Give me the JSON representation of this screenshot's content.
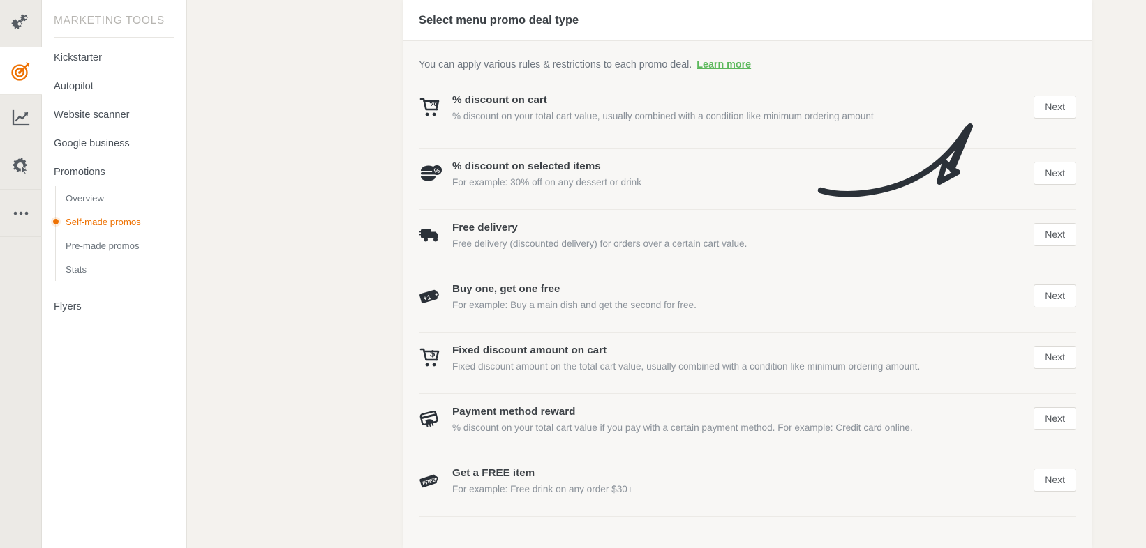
{
  "rail": {
    "items": [
      {
        "name": "settings-gears-icon",
        "active": false
      },
      {
        "name": "marketing-target-icon",
        "active": true
      },
      {
        "name": "analytics-chart-icon",
        "active": false
      },
      {
        "name": "tools-cursor-icon",
        "active": false
      },
      {
        "name": "more-options-icon",
        "active": false
      }
    ]
  },
  "sidebar": {
    "title": "MARKETING TOOLS",
    "items": [
      {
        "label": "Kickstarter"
      },
      {
        "label": "Autopilot"
      },
      {
        "label": "Website scanner"
      },
      {
        "label": "Google business"
      },
      {
        "label": "Promotions"
      }
    ],
    "subitems": [
      {
        "label": "Overview",
        "active": false
      },
      {
        "label": "Self-made promos",
        "active": true
      },
      {
        "label": "Pre-made promos",
        "active": false
      },
      {
        "label": "Stats",
        "active": false
      }
    ],
    "footer_items": [
      {
        "label": "Flyers"
      }
    ],
    "accent_color": "#ee7102"
  },
  "card": {
    "title": "Select menu promo deal type",
    "intro_text": "You can apply various rules & restrictions to each promo deal.",
    "intro_link": "Learn more",
    "link_color": "#5cb85c",
    "next_label": "Next",
    "promos": [
      {
        "icon": "cart-percent-icon",
        "name": "% discount on cart",
        "description": "% discount on your total cart value, usually combined with a condition like minimum ordering amount",
        "action": "Next"
      },
      {
        "icon": "burger-percent-icon",
        "name": "% discount on selected items",
        "description": "For example: 30% off on any dessert or drink",
        "action": "Next"
      },
      {
        "icon": "delivery-truck-icon",
        "name": "Free delivery",
        "description": "Free delivery (discounted delivery) for orders over a certain cart value.",
        "action": "Next"
      },
      {
        "icon": "plus-one-tag-icon",
        "name": "Buy one, get one free",
        "description": "For example: Buy a main dish and get the second for free.",
        "action": "Next"
      },
      {
        "icon": "cart-dollar-icon",
        "name": "Fixed discount amount on cart",
        "description": "Fixed discount amount on the total cart value, usually combined with a condition like minimum ordering amount.",
        "action": "Next"
      },
      {
        "icon": "credit-card-hand-icon",
        "name": "Payment method reward",
        "description": "% discount on your total cart value if you pay with a certain payment method. For example: Credit card online.",
        "action": "Next"
      },
      {
        "icon": "free-tag-icon",
        "name": "Get a FREE item",
        "description": "For example: Free drink on any order $30+",
        "action": "Next"
      }
    ]
  },
  "annotation": {
    "arrow": "hand-drawn-arrow-pointing-to-next-button"
  }
}
